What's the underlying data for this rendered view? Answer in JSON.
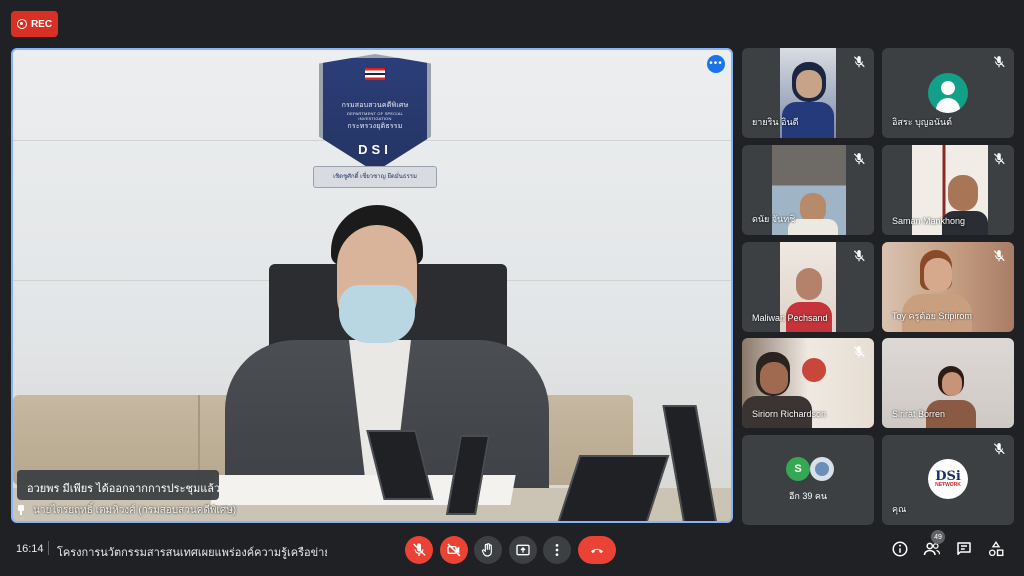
{
  "recording": {
    "label": "REC"
  },
  "main": {
    "emblem_line1": "กรมสอบสวนคดีพิเศษ",
    "emblem_line2": "DEPARTMENT OF SPECIAL INVESTIGATION",
    "emblem_line3": "กระทรวงยุติธรรม",
    "emblem_abbr": "DSI",
    "emblem_motto": "เชิดชูศักดิ์ เชี่ยวชาญ ยึดมั่นธรรม",
    "toast": "อวยพร มีเพียร ได้ออกจากการประชุมแล้ว",
    "presenter": "นายไตรยฤทธิ์ เตมหิวงศ์ (กรมสอบสวนคดีพิเศษ)",
    "more_options": "•••"
  },
  "tiles": [
    {
      "name": "ยายริน อินดี",
      "muted": true
    },
    {
      "name": "อิสระ บุญอนันต์",
      "muted": true
    },
    {
      "name": "ดนัย จันทชิ",
      "muted": true
    },
    {
      "name": "Saman Mankhong",
      "muted": true
    },
    {
      "name": "Maliwan Pechsand",
      "muted": true
    },
    {
      "name": "Toy ครูต้อย Sripirom",
      "muted": true
    },
    {
      "name": "Siriorn Richardson",
      "muted": true
    },
    {
      "name": "Sirirat Borren",
      "muted": false
    },
    {
      "name": "อีก 39 คน",
      "avatar_letter": "S"
    },
    {
      "name": "คุณ",
      "muted": true,
      "logo_big": "DSi",
      "logo_small": "NETWORK"
    }
  ],
  "bottom": {
    "time": "16:14",
    "title": "โครงการนวัตกรรมสารสนเทศเผยแพร่องค์ความรู้เครือข่าย D...",
    "participants_count": "49"
  },
  "colors": {
    "accent": "#8ab4f8",
    "danger": "#ea4335",
    "bg": "#202124",
    "tile": "#3c4043"
  }
}
